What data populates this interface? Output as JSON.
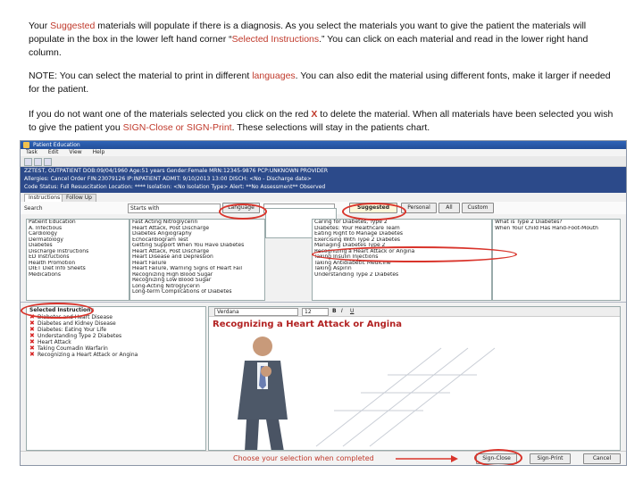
{
  "instructions": {
    "p1_a": "Your ",
    "p1_suggested": "Suggested",
    "p1_b": " materials will populate if there is a diagnosis.  As you select the materials you want to give the patient the  materials will populate in the box in the lower left hand corner “",
    "p1_selected": "Selected Instructions",
    "p1_c": ".”  You can click on each material and read in the lower right hand column.",
    "p2_a": "NOTE:  You can select the material to print in different ",
    "p2_languages": "languages",
    "p2_b": ".  You can also edit the material using different fonts, make it larger if needed for the patient.",
    "p3_a": "If you do not want one of the materials selected you click on the red ",
    "p3_x": "X",
    "p3_b": " to delete the material.  When  all materials have been selected you wish to give the patient you ",
    "p3_sign": "SIGN-Close or SIGN-Print",
    "p3_c": ".  These selections will stay in the patients chart."
  },
  "app": {
    "title": "Patient Education",
    "menu": [
      "Task",
      "Edit",
      "View",
      "Help"
    ],
    "banner_rows": [
      "ZZTEST, OUTPATIENT     DOB:09/04/1960     Age:51 years     Gender:Female     MRN:12345-9876     PCP:UNKNOWN PROVIDER",
      "Allergies: Cancel Order     FIN:23079126     IP:INPATIENT     ADMIT: 9/10/2013 13:00     DISCH: <No - Discharge date>",
      "Code Status: Full Resuscitation     Location: ****     Isolation: <No Isolation Type>     Alert: **No Assessment**     Observed"
    ],
    "tabs": [
      "Instructions",
      "Follow Up"
    ],
    "search_label": "Search",
    "search_value": "Starts with",
    "language_button": "Language",
    "suggested_tab": "Suggested",
    "personal_tab": "Personal",
    "all_tab": "All",
    "custom_tab": "Custom",
    "tree": [
      "Patient Education",
      "A. Infectious",
      "Cardiology",
      "Dermatology",
      "Diabetes",
      "Discharge Instructions",
      "ED Instructions",
      "Health Promotion",
      "DIET Diet Info Sheets",
      "Medications"
    ],
    "materials": [
      "Fast Acting Nitroglycerin",
      "Heart Attack, Post Discharge",
      "Diabetes Angiography",
      "Echocardiogram Test",
      "Getting Support When You Have Diabetes",
      "Heart Attack, Post Discharge",
      "Heart Disease and Depression",
      "Heart Failure",
      "Heart Failure, Warning Signs of Heart Fail",
      "Recognizing High Blood Sugar",
      "Recognizing Low Blood Sugar",
      "Long-Acting Nitroglycerin",
      "Long-term Complications of Diabetes"
    ],
    "suggested_list": [
      "Caring for Diabetes, Type 2",
      "Diabetes: Your Healthcare Team",
      "Eating Right to Manage Diabetes",
      "Exercising With Type 2 Diabetes",
      "Managing Diabetes Type 2",
      "Recognizing a Heart Attack or Angina",
      "Taking Insulin Injections",
      "Taking Antidiabetic Medicine",
      "Taking Aspirin",
      "Understanding Type 2 Diabetes"
    ],
    "right_info": [
      "What is Type 2 Diabetes?",
      "When Your Child Has Hand-Foot-Mouth"
    ],
    "selected_label": "Selected Instructions",
    "selected_items": [
      "Diabetes and Heart Disease",
      "Diabetes and Kidney Disease",
      "Diabetes: Eating Your Life",
      "Understanding Type 2 Diabetes",
      "Heart Attack",
      "Taking Coumadin Warfarin",
      "Recognizing a Heart Attack or Angina"
    ],
    "font_value": "Verdana",
    "font_size": "12",
    "doc_title": "Recognizing a Heart Attack or Angina",
    "footer_note": "Choose your selection when completed",
    "sign_close": "Sign-Close",
    "sign_print": "Sign-Print",
    "cancel": "Cancel"
  },
  "colors": {
    "highlight": "#c0392b",
    "circle": "#d9342b",
    "banner": "#2c4a8a",
    "x_mark": "#d62020",
    "doc_title": "#b22222"
  }
}
